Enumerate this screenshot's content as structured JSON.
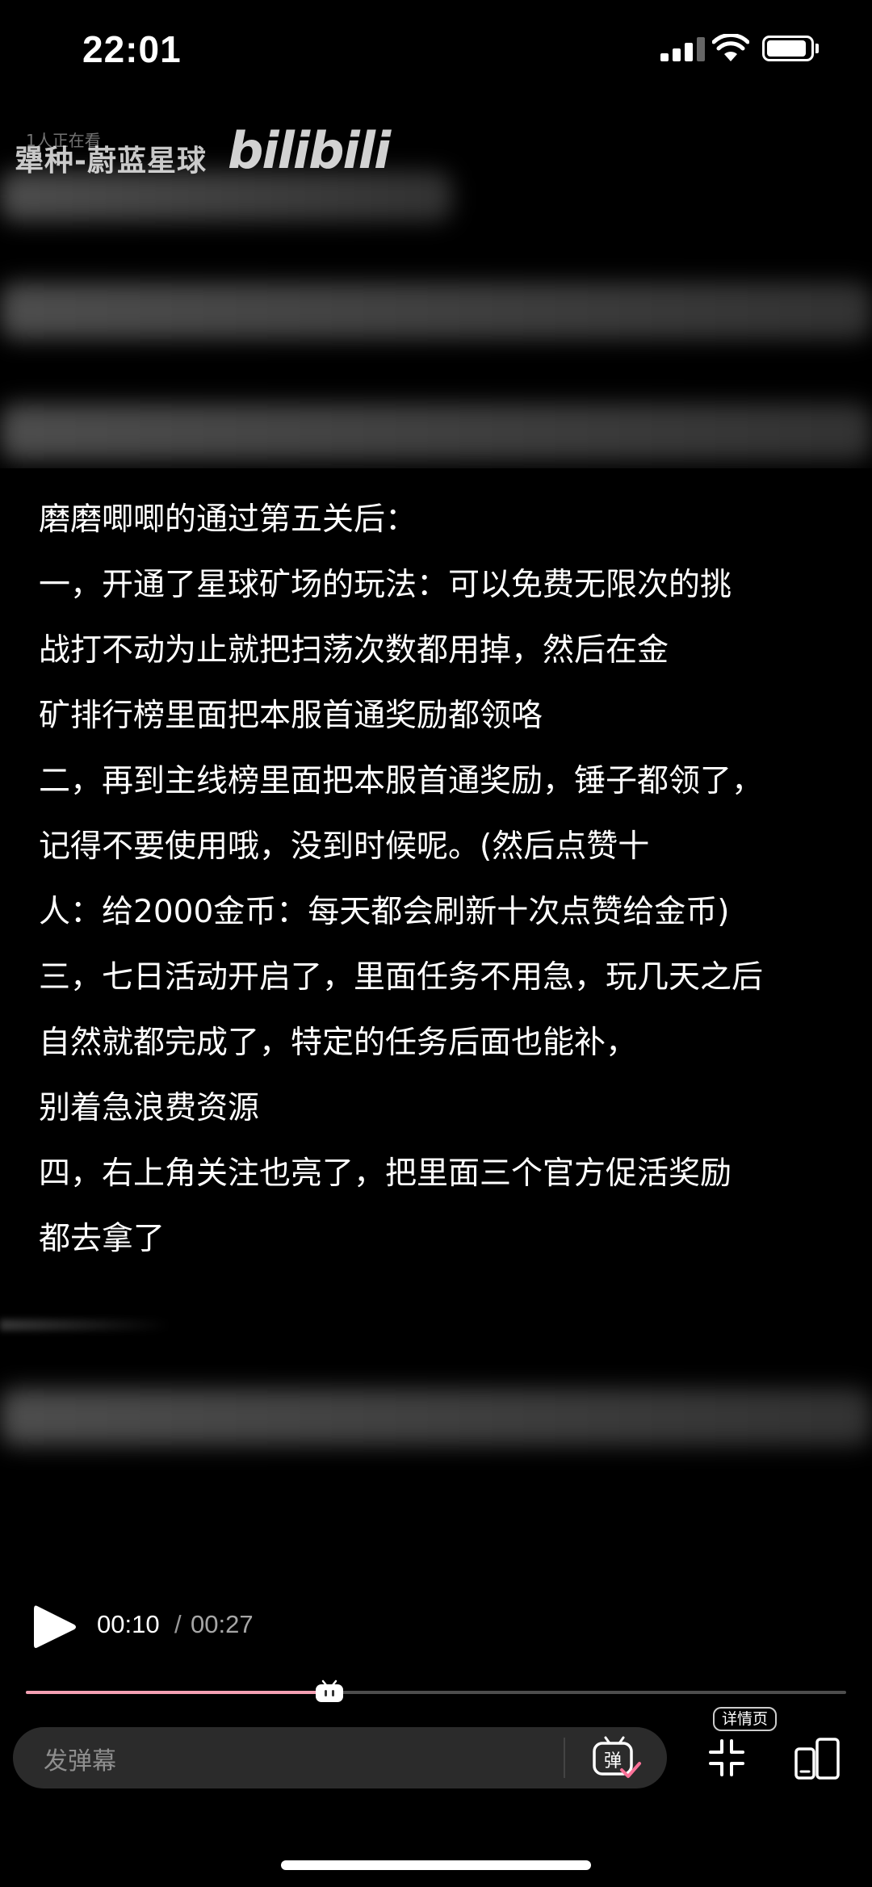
{
  "status_bar": {
    "time": "22:01"
  },
  "watermark": {
    "viewers": "1人正在看",
    "title": "犟种-蔚蓝星球",
    "logo": "bilibili"
  },
  "content_lines": [
    "磨磨唧唧的通过第五关后：",
    "一，开通了星球矿场的玩法：可以免费无限次的挑",
    "战打不动为止就把扫荡次数都用掉，然后在金",
    "矿排行榜里面把本服首通奖励都领咯",
    "二，再到主线榜里面把本服首通奖励，锤子都领了，",
    "记得不要使用哦，没到时候呢。(然后点赞十",
    "人：给2000金币：每天都会刷新十次点赞给金币)",
    "三，七日活动开启了，里面任务不用急，玩几天之后",
    "自然就都完成了，特定的任务后面也能补，",
    "别着急浪费资源",
    "四，右上角关注也亮了，把里面三个官方促活奖励",
    "都去拿了"
  ],
  "player": {
    "current_time": "00:10",
    "separator": "/",
    "total_time": "00:27",
    "progress": 0.37,
    "danmaku_placeholder": "发弹幕",
    "danmaku_toggle_label": "弹",
    "detail_label": "详情页"
  },
  "colors": {
    "progress_played": "#f3a0b3",
    "accent_pink": "#fb7299"
  }
}
